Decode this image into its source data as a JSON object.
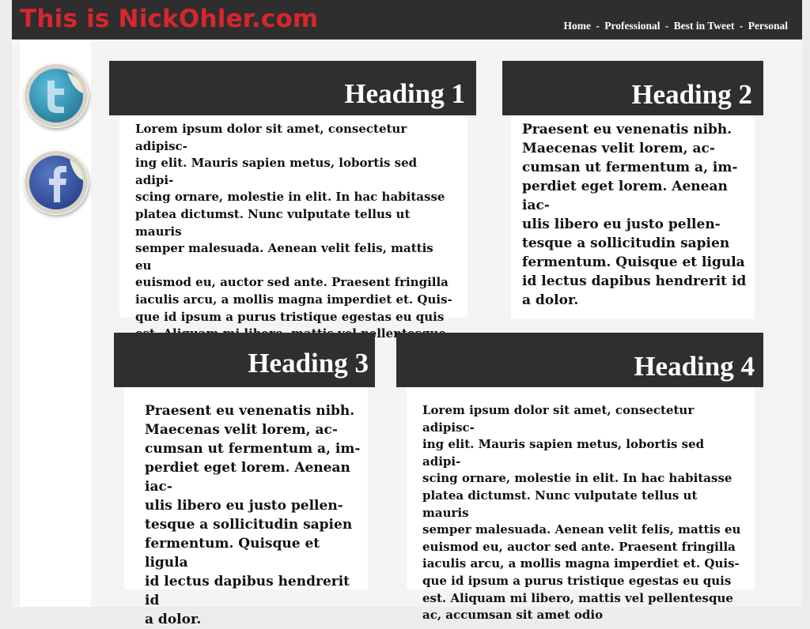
{
  "header": {
    "site_title": "This is NickOhler.com",
    "nav": [
      "Home",
      "Professional",
      "Best in Tweet",
      "Personal"
    ],
    "separator": "-"
  },
  "social": [
    {
      "name": "twitter",
      "icon": "twitter-icon",
      "color": "#3aa0c0"
    },
    {
      "name": "facebook",
      "icon": "facebook-icon",
      "color": "#3d5ba8"
    }
  ],
  "colors": {
    "header_bg": "#2e2e2e",
    "title_red": "#d7262c",
    "heading_bg": "#2f2f2f",
    "page_bg": "#f4f4f4"
  },
  "sections": [
    {
      "heading": "Heading 1",
      "body": "Lorem ipsum dolor sit amet, consectetur adipisc-\ning elit. Mauris sapien metus, lobortis sed adipi-\nscing ornare, molestie in elit. In hac habitasse\nplatea dictumst. Nunc vulputate tellus ut mauris\nsemper malesuada. Aenean velit felis, mattis eu\neuismod eu, auctor sed ante. Praesent fringilla\niaculis arcu, a mollis magna imperdiet et. Quis-\nque id ipsum a purus tristique egestas eu quis\nest. Aliquam mi libero, mattis vel pellentesque\nac, accumsan sit amet odio"
    },
    {
      "heading": "Heading 2",
      "body": "Praesent eu venenatis nibh.\nMaecenas velit lorem, ac-\ncumsan ut fermentum a, im-\nperdiet eget lorem. Aenean iac-\nulis libero eu justo pellen-\ntesque a sollicitudin sapien\nfermentum. Quisque et ligula\nid lectus dapibus hendrerit id\na dolor."
    },
    {
      "heading": "Heading 3",
      "body": "Praesent eu venenatis nibh.\nMaecenas velit lorem, ac-\ncumsan ut fermentum a, im-\nperdiet eget lorem. Aenean iac-\nulis libero eu justo pellen-\ntesque a sollicitudin sapien\nfermentum. Quisque et ligula\nid lectus dapibus hendrerit id\na dolor."
    },
    {
      "heading": "Heading 4",
      "body": "Lorem ipsum dolor sit amet, consectetur adipisc-\ning elit. Mauris sapien metus, lobortis sed adipi-\nscing ornare, molestie in elit. In hac habitasse\nplatea dictumst. Nunc vulputate tellus ut mauris\nsemper malesuada. Aenean velit felis, mattis eu\neuismod eu, auctor sed ante. Praesent fringilla\niaculis arcu, a mollis magna imperdiet et. Quis-\nque id ipsum a purus tristique egestas eu quis\nest. Aliquam mi libero, mattis vel pellentesque\nac, accumsan sit amet odio"
    }
  ]
}
